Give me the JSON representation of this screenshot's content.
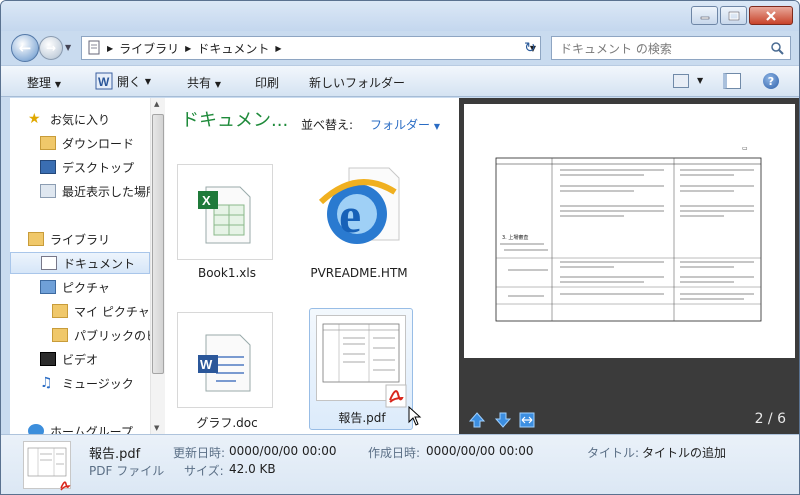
{
  "address": {
    "crumbs": [
      "ライブラリ",
      "ドキュメント"
    ]
  },
  "search": {
    "placeholder": "ドキュメント の検索"
  },
  "toolbar": {
    "organize": "整理",
    "open": "開く",
    "share": "共有",
    "print": "印刷",
    "new_folder": "新しいフォルダー"
  },
  "nav": {
    "favorites": "お気に入り",
    "downloads": "ダウンロード",
    "desktop": "デスクトップ",
    "recent": "最近表示した場所",
    "libraries": "ライブラリ",
    "documents": "ドキュメント",
    "pictures": "ピクチャ",
    "my_pictures": "マイ ピクチャ",
    "public": "パブリックのピ",
    "videos": "ビデオ",
    "music": "ミュージック",
    "homegroup": "ホームグループ"
  },
  "library": {
    "title": "ドキュメン...",
    "arrange_label": "並べ替え:",
    "arrange_value": "フォルダー"
  },
  "files": [
    {
      "name": "Book1.xls"
    },
    {
      "name": "PVREADME.HTM"
    },
    {
      "name": "グラフ.doc"
    },
    {
      "name": "報告.pdf"
    }
  ],
  "preview": {
    "page_indicator": "2 / 6",
    "page_heading": "3. 上場審査"
  },
  "details": {
    "filename": "報告.pdf",
    "filetype": "PDF ファイル",
    "modified_label": "更新日時:",
    "modified": "0000/00/00 00:00",
    "created_label": "作成日時:",
    "created": "0000/00/00 00:00",
    "size_label": "サイズ:",
    "size": "42.0 KB",
    "title_label": "タイトル:",
    "title_value": "タイトルの追加"
  },
  "colors": {
    "accent": "#1e8a3a",
    "link": "#2a6cc4",
    "preview_bg": "#3b3b3b"
  }
}
